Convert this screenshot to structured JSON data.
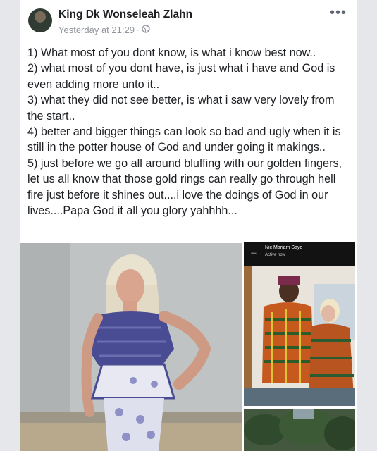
{
  "post": {
    "author": "King Dk Wonseleah Zlahn",
    "timestamp": "Yesterday at 21:29",
    "separator": "·",
    "privacy_icon": "globe-icon",
    "more_icon": "more-options-icon",
    "more_label": "•••",
    "text_lines": [
      "1) What most of you dont  know, is what i know best now..",
      "2) what most of you dont have, is just what i have  and God is even adding more unto it..",
      "3) what they did not see better, is what i saw very lovely from the start..",
      "4) better and bigger things can look so bad and ugly when it is still in the potter house of God and under going it makings..",
      "5) just before we go all around bluffing with our golden fingers, let us all know that those gold rings can really go through hell fire just before it shines out....i love the doings of God in our lives....Papa God it all you glory yahhhh..."
    ]
  },
  "photos": {
    "chat_screenshot": {
      "back_icon": "back-arrow-icon",
      "back_glyph": "←",
      "contact_name": "Nic Mariam Saye",
      "status": "Active now"
    }
  }
}
